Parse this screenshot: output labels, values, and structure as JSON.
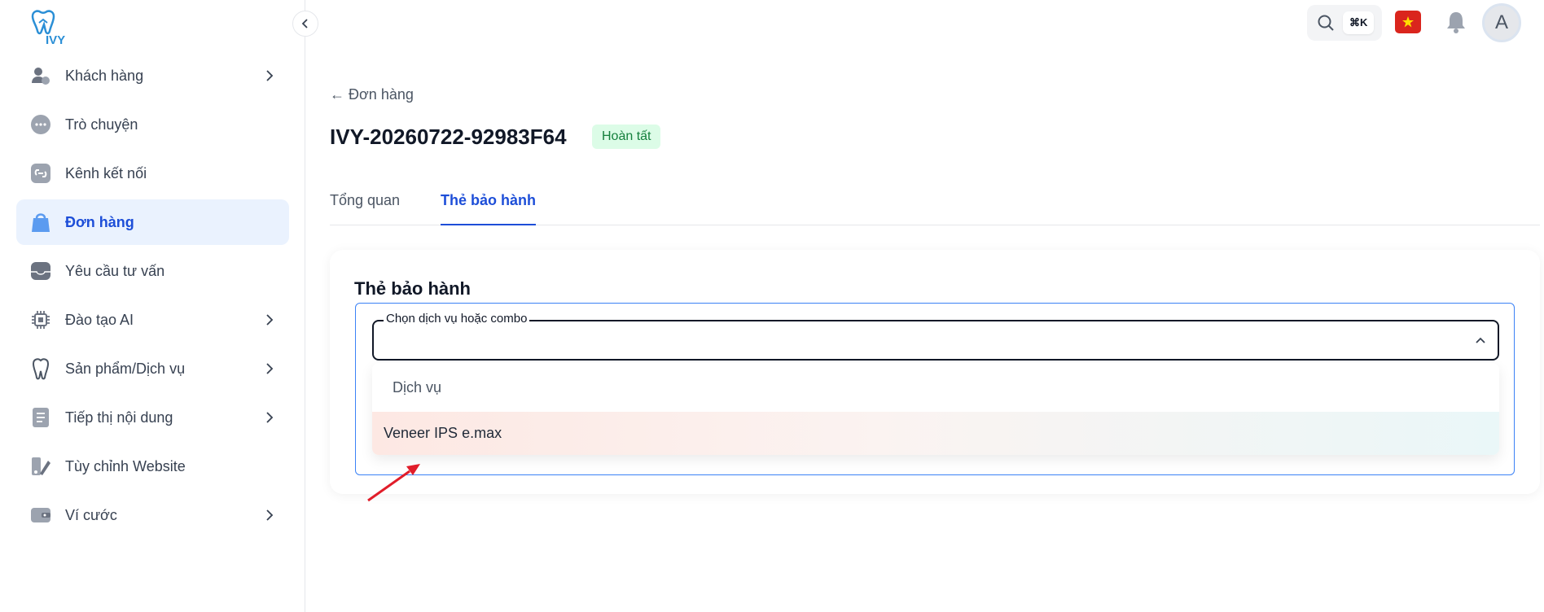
{
  "brand": {
    "logo_text": "IVY"
  },
  "sidebar": {
    "items": [
      {
        "label": "Khách hàng",
        "icon": "users-icon",
        "has_submenu": true,
        "active": false
      },
      {
        "label": "Trò chuyện",
        "icon": "chat-icon",
        "has_submenu": false,
        "active": false
      },
      {
        "label": "Kênh kết nối",
        "icon": "link-icon",
        "has_submenu": false,
        "active": false
      },
      {
        "label": "Đơn hàng",
        "icon": "shopping-bag-icon",
        "has_submenu": false,
        "active": true
      },
      {
        "label": "Yêu cầu tư vấn",
        "icon": "inbox-icon",
        "has_submenu": false,
        "active": false
      },
      {
        "label": "Đào tạo AI",
        "icon": "chip-icon",
        "has_submenu": true,
        "active": false
      },
      {
        "label": "Sản phẩm/Dịch vụ",
        "icon": "tooth-icon",
        "has_submenu": true,
        "active": false
      },
      {
        "label": "Tiếp thị nội dung",
        "icon": "document-icon",
        "has_submenu": true,
        "active": false
      },
      {
        "label": "Tùy chỉnh Website",
        "icon": "brush-icon",
        "has_submenu": false,
        "active": false
      },
      {
        "label": "Ví cước",
        "icon": "wallet-icon",
        "has_submenu": true,
        "active": false
      }
    ]
  },
  "topbar": {
    "search_shortcut": "⌘K",
    "avatar_initial": "A",
    "language_flag": "vietnam-flag-icon"
  },
  "main": {
    "back_label": "← Đơn hàng",
    "order_code": "IVY-20260722-92983F64",
    "status": "Hoàn tất",
    "tabs": [
      {
        "label": "Tổng quan",
        "active": false
      },
      {
        "label": "Thẻ bảo hành",
        "active": true
      }
    ],
    "card": {
      "title": "Thẻ bảo hành",
      "select_label": "Chọn dịch vụ hoặc combo",
      "select_value": "",
      "dropdown_group": "Dịch vụ",
      "dropdown_options": [
        "Veneer IPS e.max"
      ]
    }
  },
  "colors": {
    "accent": "#1d4ed8",
    "active_bg": "#eaf2fe",
    "success_bg": "#dcfce7",
    "success_text": "#15803d",
    "annotation_arrow": "#e11d2a"
  }
}
